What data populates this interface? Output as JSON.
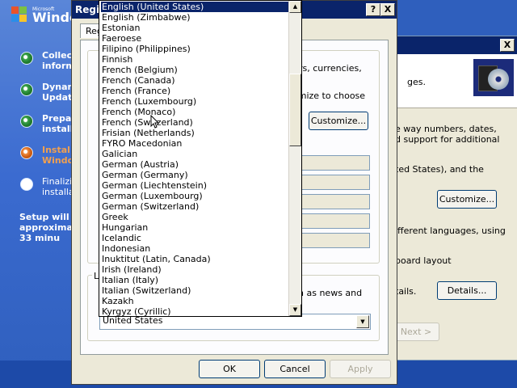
{
  "setup": {
    "logo_ms": "Microsoft",
    "logo_word": "Windo",
    "steps": [
      {
        "text": "Collect\ninform",
        "state": "done"
      },
      {
        "text": "Dynam\nUpdate",
        "state": "done"
      },
      {
        "text": "Prepar\ninstall",
        "state": "done"
      },
      {
        "text": "Instal\nWindo",
        "state": "current"
      },
      {
        "text": "Finalizi\ninstalla",
        "state": "pending"
      }
    ],
    "note": "Setup will c\napproximat\n33 minu"
  },
  "back_dialog": {
    "close": "X",
    "header_text": "ges.",
    "text1": "rs, currencies,",
    "text2": "omize to choose",
    "para1a": "e way numbers, dates,",
    "para1b": "d support for additional",
    "para2": "ted States), and the",
    "customize2": "Customize...",
    "para3": "ifferent languages, using",
    "para4": "board layout",
    "para5": "tails.",
    "details": "Details...",
    "next": "Next >"
  },
  "dialog": {
    "title": "Regi",
    "help": "?",
    "close": "X",
    "tab": "Reg",
    "customize": "Customize...",
    "group2_label": "L",
    "text_news": "uch as news and",
    "combo_value": "United States",
    "ok": "OK",
    "cancel": "Cancel",
    "apply": "Apply"
  },
  "dropdown": {
    "items": [
      "English (United States)",
      "English (Zimbabwe)",
      "Estonian",
      "Faeroese",
      "Filipino (Philippines)",
      "Finnish",
      "French (Belgium)",
      "French (Canada)",
      "French (France)",
      "French (Luxembourg)",
      "French (Monaco)",
      "French (Switzerland)",
      "Frisian (Netherlands)",
      "FYRO Macedonian",
      "Galician",
      "German (Austria)",
      "German (Germany)",
      "German (Liechtenstein)",
      "German (Luxembourg)",
      "German (Switzerland)",
      "Greek",
      "Hungarian",
      "Icelandic",
      "Indonesian",
      "Inuktitut (Latin, Canada)",
      "Irish (Ireland)",
      "Italian (Italy)",
      "Italian (Switzerland)",
      "Kazakh",
      "Kyrgyz (Cyrillic)"
    ],
    "selected_index": 0
  }
}
